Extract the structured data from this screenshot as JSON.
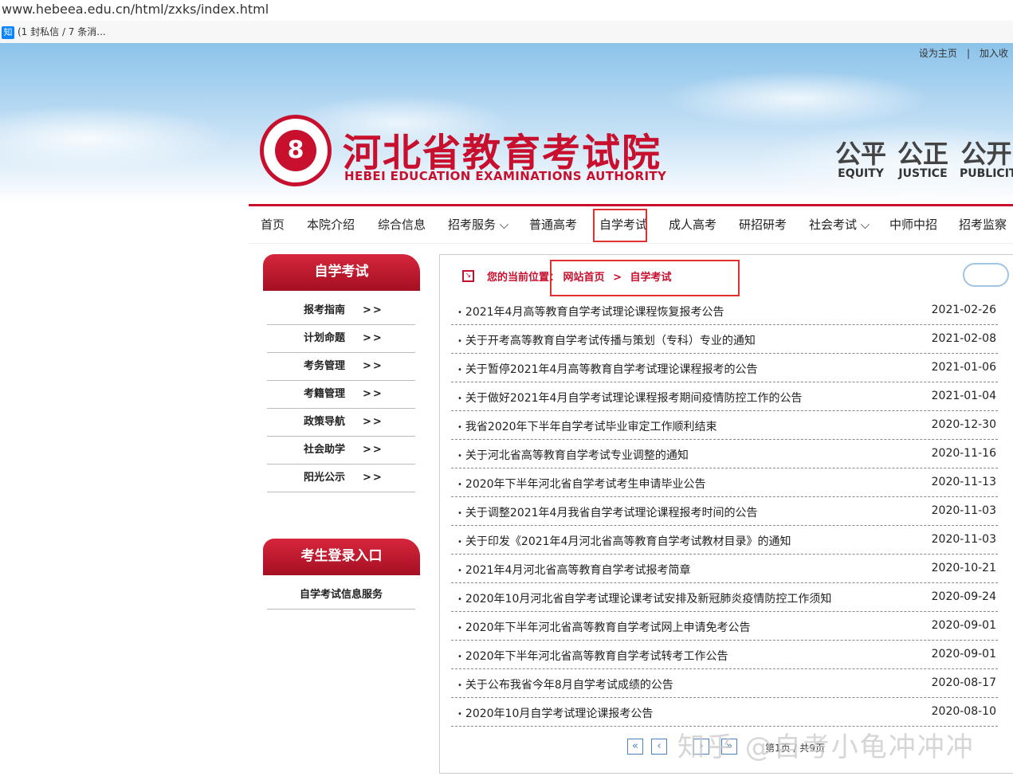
{
  "browser": {
    "url": "www.hebeea.edu.cn/html/zxks/index.html",
    "bookmark_icon": "知",
    "bookmark_text": "(1 封私信 / 7 条消..."
  },
  "header": {
    "toplinks": [
      "设为主页",
      "|",
      "加入收"
    ],
    "seal_glyph": "8",
    "title": "河北省教育考试院",
    "title_en": "HEBEI EDUCATION EXAMINATIONS AUTHORITY",
    "mottos": [
      {
        "zh": "公平",
        "en": "EQUITY"
      },
      {
        "zh": "公正",
        "en": "JUSTICE"
      },
      {
        "zh": "公开",
        "en": "PUBLICIT"
      }
    ]
  },
  "nav": [
    "首页",
    "本院介绍",
    "综合信息",
    "招考服务 ⌵",
    "普通高考",
    "自学考试",
    "成人高考",
    "研招研考",
    "社会考试 ⌵",
    "中师中招",
    "招考监察"
  ],
  "sidebar": {
    "section1": "自学考试",
    "items": [
      "报考指南",
      "计划命题",
      "考务管理",
      "考籍管理",
      "政策导航",
      "社会助学",
      "阳光公示"
    ],
    "arrow": ">>",
    "section2": "考生登录入口",
    "service": "自学考试信息服务"
  },
  "breadcrumb": {
    "label": "您的当前位置：",
    "home": "网站首页",
    "sep": ">",
    "current": "自学考试"
  },
  "news": [
    {
      "title": "2021年4月高等教育自学考试理论课程恢复报考公告",
      "date": "2021-02-26"
    },
    {
      "title": "关于开考高等教育自学考试传播与策划（专科）专业的通知",
      "date": "2021-02-08"
    },
    {
      "title": "关于暂停2021年4月高等教育自学考试理论课程报考的公告",
      "date": "2021-01-06"
    },
    {
      "title": "关于做好2021年4月自学考试理论课程报考期间疫情防控工作的公告",
      "date": "2021-01-04"
    },
    {
      "title": "我省2020年下半年自学考试毕业审定工作顺利结束",
      "date": "2020-12-30"
    },
    {
      "title": "关于河北省高等教育自学考试专业调整的通知",
      "date": "2020-11-16"
    },
    {
      "title": "2020年下半年河北省自学考试考生申请毕业公告",
      "date": "2020-11-13"
    },
    {
      "title": "关于调整2021年4月我省自学考试理论课程报考时间的公告",
      "date": "2020-11-03"
    },
    {
      "title": "关于印发《2021年4月河北省高等教育自学考试教材目录》的通知",
      "date": "2020-11-03"
    },
    {
      "title": "2021年4月河北省高等教育自学考试报考简章",
      "date": "2020-10-21"
    },
    {
      "title": "2020年10月河北省自学考试理论课考试安排及新冠肺炎疫情防控工作须知",
      "date": "2020-09-24"
    },
    {
      "title": "2020年下半年河北省高等教育自学考试网上申请免考公告",
      "date": "2020-09-01"
    },
    {
      "title": "2020年下半年河北省高等教育自学考试转考工作公告",
      "date": "2020-09-01"
    },
    {
      "title": "关于公布我省今年8月自学考试成绩的公告",
      "date": "2020-08-17"
    },
    {
      "title": "2020年10月自学考试理论课报考公告",
      "date": "2020-08-10"
    }
  ],
  "pagination": {
    "first": "«",
    "prev": "‹",
    "next": "›",
    "last": "»",
    "info": "第1页 / 共9页"
  },
  "watermark": "知乎 @自考小龟冲冲冲"
}
